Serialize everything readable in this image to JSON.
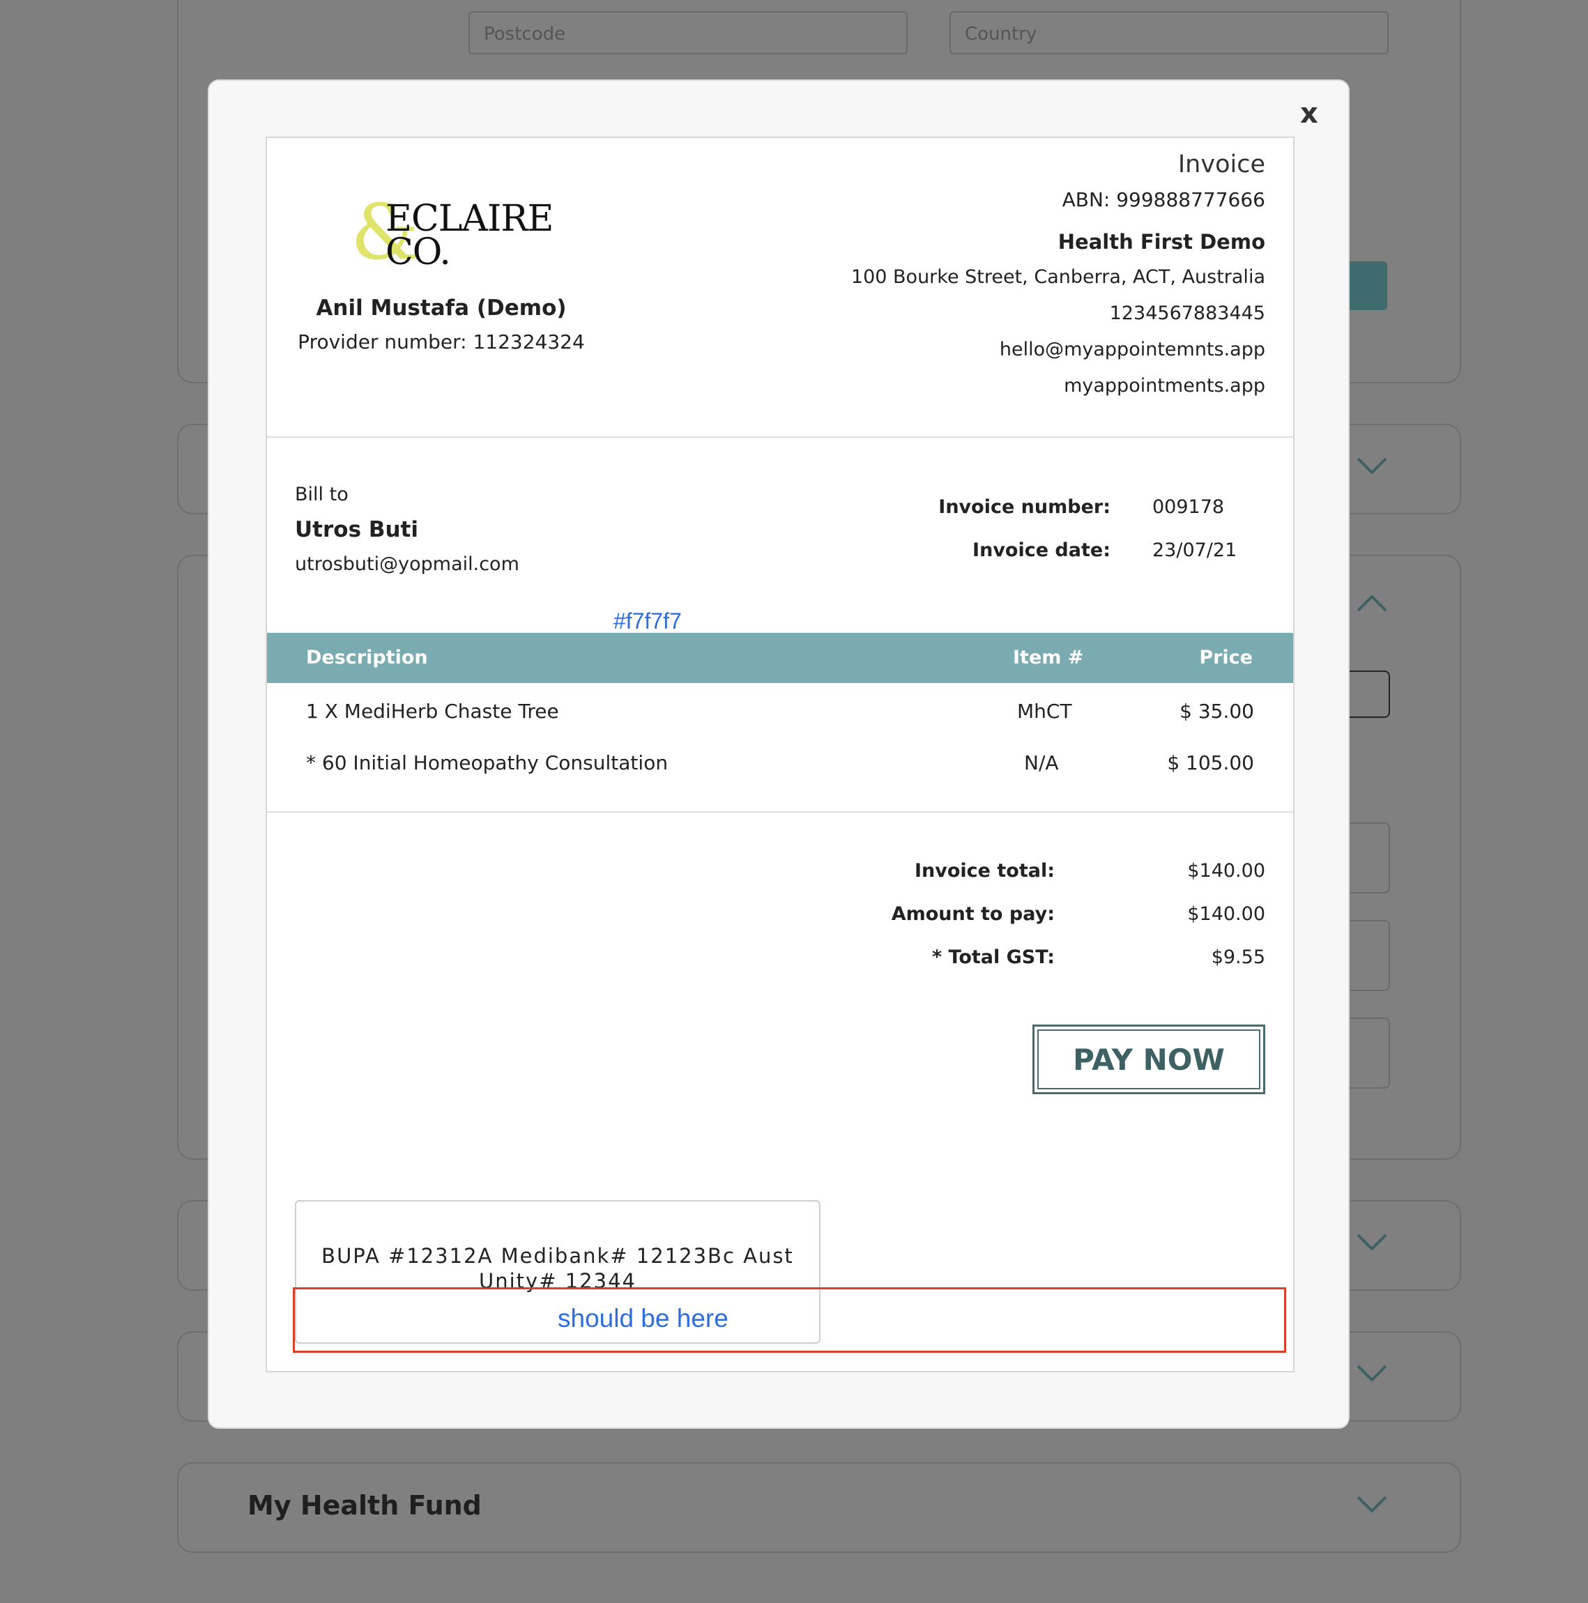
{
  "background": {
    "postcode_placeholder": "Postcode",
    "country_placeholder": "Country",
    "health_fund_label": "My Health Fund"
  },
  "modal": {
    "close_label": "x"
  },
  "invoice": {
    "title": "Invoice",
    "logo": "ECLAIRE & CO.",
    "abn": "ABN: 999888777666",
    "business_name": "Health First Demo",
    "address": "100 Bourke Street, Canberra, ACT, Australia",
    "phone": "1234567883445",
    "email": "hello@myappointemnts.app",
    "website": "myappointments.app",
    "provider_name": "Anil Mustafa (Demo)",
    "provider_number": "Provider number: 112324324",
    "bill_to_label": "Bill to",
    "client_name": "Utros Buti",
    "client_email": "utrosbuti@yopmail.com",
    "invoice_number_label": "Invoice number:",
    "invoice_number": "009178",
    "invoice_date_label": "Invoice date:",
    "invoice_date": "23/07/21",
    "table": {
      "headers": [
        "Description",
        "Item #",
        "Price"
      ],
      "rows": [
        {
          "description": "1 X MediHerb Chaste Tree",
          "item": "MhCT",
          "price": "$ 35.00"
        },
        {
          "description": "* 60 Initial Homeopathy Consultation",
          "item": "N/A",
          "price": "$ 105.00"
        }
      ]
    },
    "totals": {
      "invoice_total_label": "Invoice total:",
      "invoice_total": "$140.00",
      "amount_to_pay_label": "Amount to pay:",
      "amount_to_pay": "$140.00",
      "gst_label": "* Total GST:",
      "gst": "$9.55"
    },
    "pay_now_label": "PAY NOW",
    "health_fund_text_line1": "BUPA #12312A Medibank# 12123Bc Aust",
    "health_fund_text_line2": "Unity# 12344"
  },
  "annotations": {
    "color_note": "#f7f7f7",
    "placement_note": "should be here",
    "note_color": "#2d6de0",
    "box_color": "#d9402c"
  },
  "colors": {
    "overlay": "#7f7f7f",
    "modal_bg": "#f7f7f7",
    "table_header": "#7aabb1",
    "pay_button_text": "#3e6165"
  }
}
